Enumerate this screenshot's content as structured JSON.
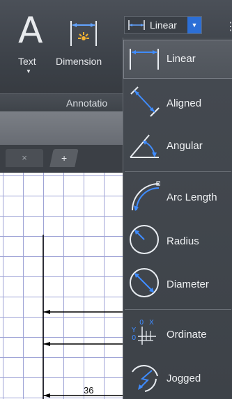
{
  "ribbon": {
    "text_tool": {
      "label": "Text",
      "glyph": "A"
    },
    "dimension_tool": {
      "label": "Dimension"
    },
    "dimstyle_combo": {
      "value": "Linear"
    },
    "panel_title": "Annotatio"
  },
  "tabs": {
    "close_glyph": "×",
    "add_glyph": "+"
  },
  "drawing": {
    "dimension_value": "36"
  },
  "menu": {
    "items": [
      {
        "label": "Linear",
        "icon": "linear-dim-icon"
      },
      {
        "label": "Aligned",
        "icon": "aligned-dim-icon"
      },
      {
        "label": "Angular",
        "icon": "angular-dim-icon"
      },
      {
        "label": "Arc Length",
        "icon": "arc-length-dim-icon"
      },
      {
        "label": "Radius",
        "icon": "radius-dim-icon"
      },
      {
        "label": "Diameter",
        "icon": "diameter-dim-icon"
      },
      {
        "label": "Ordinate",
        "icon": "ordinate-dim-icon"
      },
      {
        "label": "Jogged",
        "icon": "jogged-dim-icon"
      }
    ],
    "selected": "Linear"
  },
  "colors": {
    "ribbon_bg": "#3b4047",
    "accent_blue": "#2c6fd6",
    "menu_bg": "#454a51",
    "grid_line": "#9ea3d6"
  }
}
